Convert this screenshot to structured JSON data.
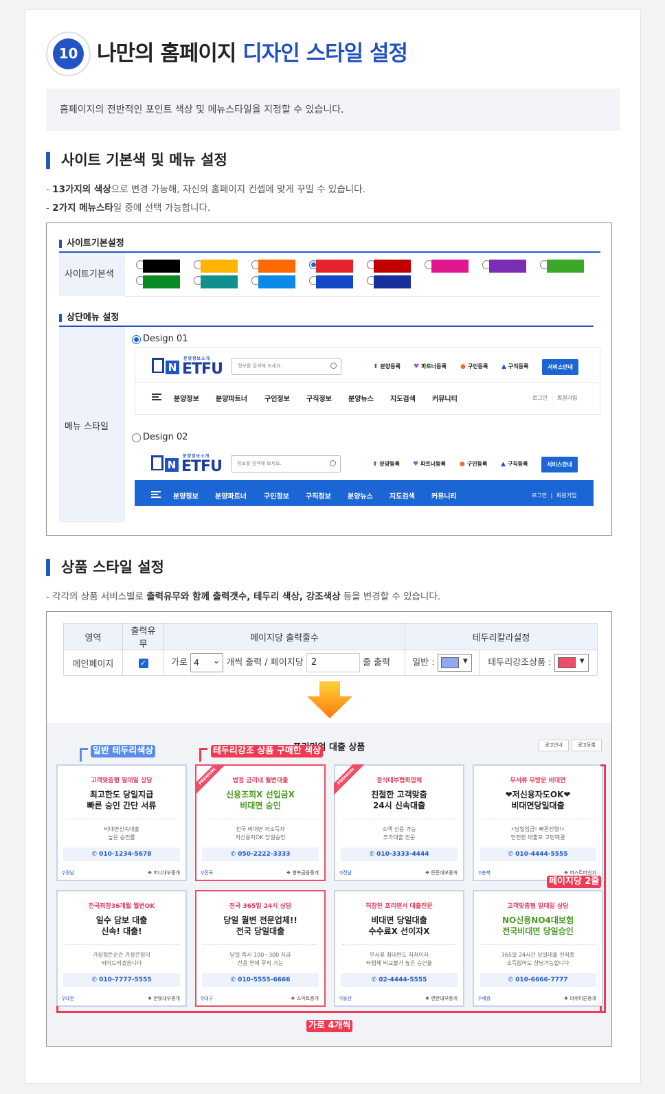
{
  "section10": {
    "number": "10",
    "title_main": "나만의 홈페이지 ",
    "title_highlight": "디자인 스타일 설정",
    "intro": "홈페이지의 전반적인 포인트 색상 및 메뉴스타일을 지정할 수 있습니다."
  },
  "site_settings": {
    "heading": "사이트 기본색 및 메뉴 설정",
    "desc1_a": "- ",
    "desc1_b": "13가지의 색상",
    "desc1_c": "으로 변경 가능해, 자신의 홈페이지 컨셉에 맞게 꾸밀 수 있습니다.",
    "desc2_a": "- ",
    "desc2_b": "2가지 메뉴스타",
    "desc2_c": "일 중에 선택 가능합니다.",
    "panel_title": "사이트기본설정",
    "color_row_label": "사이트기본색",
    "colors": [
      "#000000",
      "#ffb400",
      "#ff6a00",
      "#e7242c",
      "#c30000",
      "#e0178f",
      "#7b2eb3",
      "#3da827",
      "#0a8a25",
      "#108f8f",
      "#0b8ae8",
      "#1348c9",
      "#172f9b"
    ],
    "selected_color_index": 3,
    "menu_panel_title": "상단메뉴 설정",
    "menu_row_label": "메뉴 스타일",
    "design1_label": "Design 01",
    "design2_label": "Design 02",
    "selected_design": 1
  },
  "site_header_preview": {
    "logo_sub": "분양정보소개",
    "logo_word": "ETFU",
    "logo_n": "N",
    "search_placeholder": "정보를 검색해 보세요.",
    "top_links": [
      "분양등록",
      "파트너등록",
      "구인등록",
      "구직등록"
    ],
    "service_button": "서비스안내",
    "nav_items": [
      "분양정보",
      "분양파트너",
      "구인정보",
      "구직정보",
      "분양뉴스",
      "지도검색",
      "커뮤니티"
    ],
    "login": "로그인",
    "join": "회원가입",
    "nav_accent": "#1b66d4"
  },
  "product_settings": {
    "heading": "상품 스타일 설정",
    "desc_a": "- 각각의 상품 서비스별로 ",
    "desc_b": "출력유무와 함께 출력갯수, 테두리 색상, 강조색상",
    "desc_c": " 등을 변경할 수 있습니다.",
    "table_headers": [
      "영역",
      "출력유무",
      "페이지당 출력줄수",
      "테두리칼라설정"
    ],
    "row_area": "메인페이지",
    "row_checked": true,
    "garo": "가로",
    "garo_value": "4",
    "per_line": "개씩 출력 / ",
    "per_page_label": "페이지당",
    "lines_value": "2",
    "line_output": "줄 출력",
    "normal_label": "일반 :",
    "normal_color": "#8fa8f3",
    "highlight_label": "테두리강조상품 :",
    "highlight_color": "#ee4d6a"
  },
  "preview": {
    "title": "프리미엄 대출 상품",
    "tag_normal": "일반 테두리색상",
    "tag_highlight": "테두리강조 상품 구매한 색상",
    "ad_info": "광고안내",
    "ad_register": "광고등록",
    "tag_rows": "페이지당 2줄",
    "tag_cols": "가로 4개씩",
    "premium": "PREMIUM",
    "cards": [
      {
        "top": "고객맞춤형 일대일 상담",
        "head": "최고한도 당일지급\n빠른 승인 간단 서류",
        "green": false,
        "desc": "비대면신속대출\n높은 승인률",
        "phone": "010-1234-5678",
        "region": "경남",
        "company": "머니대부중개",
        "hl": false,
        "premium": false
      },
      {
        "top": "법정 금리내 월변대출",
        "head": "신용조회X 선입금X\n비대면 승인",
        "green": true,
        "desc": "전국 비대면 저소득자\n저신용자OK 당일승인",
        "phone": "050-2222-3333",
        "region": "전국",
        "company": "행복금융중개",
        "hl": true,
        "premium": true
      },
      {
        "top": "정식대부협회업체",
        "head": "친절한 고객맞춤\n24시 신속대출",
        "green": false,
        "desc": "소액 신용 가능\n추가대출 전문",
        "phone": "010-3333-4444",
        "region": "전남",
        "company": "든든대부중개",
        "hl": false,
        "premium": true
      },
      {
        "top": "무서류 무방문 비대면",
        "head": "❤저신용자도OK❤\n비대면당일대출",
        "green": false,
        "desc": "⚡당일입금! 빠른진행!⚡\n안전한 대출로 고민해결",
        "phone": "010-4444-5555",
        "region": "충북",
        "company": "퍼스트머칫지",
        "hl": false,
        "premium": false
      },
      {
        "top": "전국최장36개월 월변OK",
        "head": "일수 담보 대출\n신속! 대출!",
        "green": false,
        "desc": "가장힘든순간 가장큰힘이\n되어드리겠습니다",
        "phone": "010-7777-5555",
        "region": "대전",
        "company": "한빛대부중개",
        "hl": false,
        "premium": false
      },
      {
        "top": "전국 365일 24시 상담",
        "head": "당일 월변 전문업체!!\n전국 당일대출",
        "green": false,
        "desc": "당일 즉시 100~300 지급\n신용 연체 무직 가능",
        "phone": "010-5555-6666",
        "region": "대구",
        "company": "스마트중개",
        "hl": true,
        "premium": false
      },
      {
        "top": "직장인 프리랜서 대출전문",
        "head": "비대면 당일대출\n수수료X 선이자X",
        "green": false,
        "desc": "무서류 최대한도 처처이자\n타업체 비교불가 높은 승인율",
        "phone": "02-4444-5555",
        "region": "울산",
        "company": "편한대부중개",
        "hl": false,
        "premium": false
      },
      {
        "top": "고객맞춤형 일대일 상담",
        "head": "NO신용NO4대보험\n전국비대면 당일승인",
        "green": true,
        "desc": "365일 24시간 당일대출 전직종\n소득없어도 상담가능합니다",
        "phone": "010-6666-7777",
        "region": "세종",
        "company": "더케이론중개",
        "hl": false,
        "premium": false
      }
    ]
  }
}
